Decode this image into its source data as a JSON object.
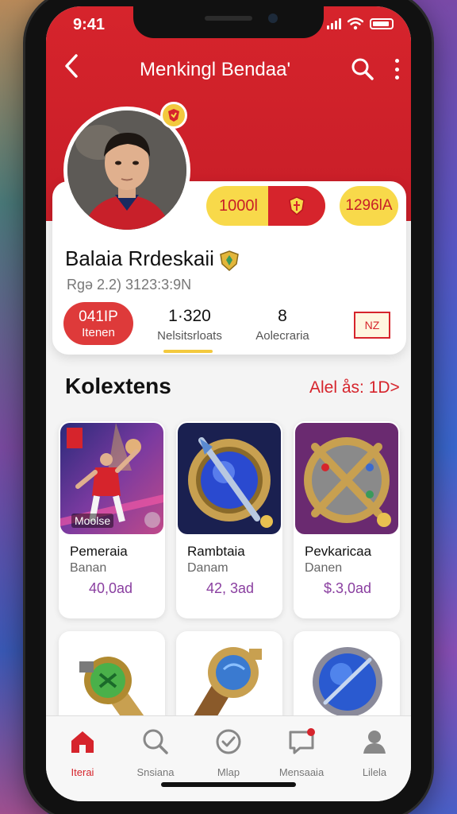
{
  "status": {
    "time": "9:41"
  },
  "nav": {
    "title": "Menkingl Bendaa'"
  },
  "profile": {
    "pill_left": "1000l",
    "pill_right": "1296lA",
    "name": "Balaia Rrdeskaii",
    "meta": "Rgə 2.2) 3123:3:9N",
    "stats": [
      {
        "value": "041IP",
        "label": "Itenen"
      },
      {
        "value": "1·320",
        "label": "Nelsitsrloats"
      },
      {
        "value": "8",
        "label": "Aolecraria"
      }
    ],
    "badge_box": "NZ"
  },
  "collections": {
    "title": "Kolextens",
    "link": "Alel ås: 1D>",
    "cards": [
      {
        "art_label": "Moolse",
        "title": "Pemeraia",
        "subtitle": "Banan",
        "price": "40,0ad"
      },
      {
        "art_label": "",
        "title": "Rambtaia",
        "subtitle": "Danam",
        "price": "42, 3ad"
      },
      {
        "art_label": "",
        "title": "Pevkaricaa",
        "subtitle": "Danen",
        "price": "$.3,0ad"
      }
    ]
  },
  "tabs": [
    {
      "label": "Iterai",
      "icon": "home-icon"
    },
    {
      "label": "Snsiana",
      "icon": "search-icon"
    },
    {
      "label": "Mlap",
      "icon": "check-circle-icon"
    },
    {
      "label": "Mensaaia",
      "icon": "chat-icon"
    },
    {
      "label": "Lilela",
      "icon": "user-icon"
    }
  ],
  "colors": {
    "primary": "#d6242c",
    "accent": "#f8d94a",
    "price": "#8a3fa0"
  }
}
